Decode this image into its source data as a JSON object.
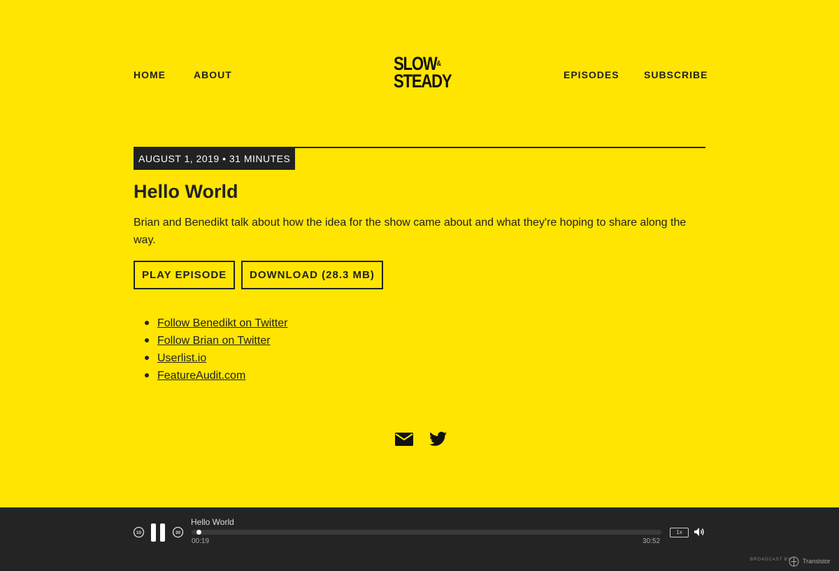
{
  "nav": {
    "left": [
      "HOME",
      "ABOUT"
    ],
    "right": [
      "EPISODES",
      "SUBSCRIBE"
    ],
    "logo_line1": "SLOW",
    "logo_amp": "&",
    "logo_line2": "STEADY"
  },
  "episode": {
    "meta": "AUGUST 1, 2019 • 31 MINUTES",
    "title": "Hello World",
    "description": "Brian and Benedikt talk about how the idea for the show came about and what they're hoping to share along the way.",
    "play_label": "PLAY EPISODE",
    "download_label": "DOWNLOAD (28.3 MB)",
    "links": [
      "Follow Benedikt on Twitter",
      "Follow Brian on Twitter",
      "Userlist.io",
      "FeatureAudit.com"
    ]
  },
  "social": {
    "icons": [
      "email-icon",
      "twitter-icon"
    ]
  },
  "player": {
    "title": "Hello World",
    "elapsed": "00:19",
    "duration": "30:52",
    "progress_fraction": 0.01,
    "speed": "1x",
    "rewind_seconds": "10",
    "forward_seconds": "30",
    "broadcast_label": "BROADCAST BY",
    "brand": "Transistor"
  },
  "colors": {
    "background": "#FFE500",
    "ink": "#222222",
    "player_bg": "#242424"
  }
}
